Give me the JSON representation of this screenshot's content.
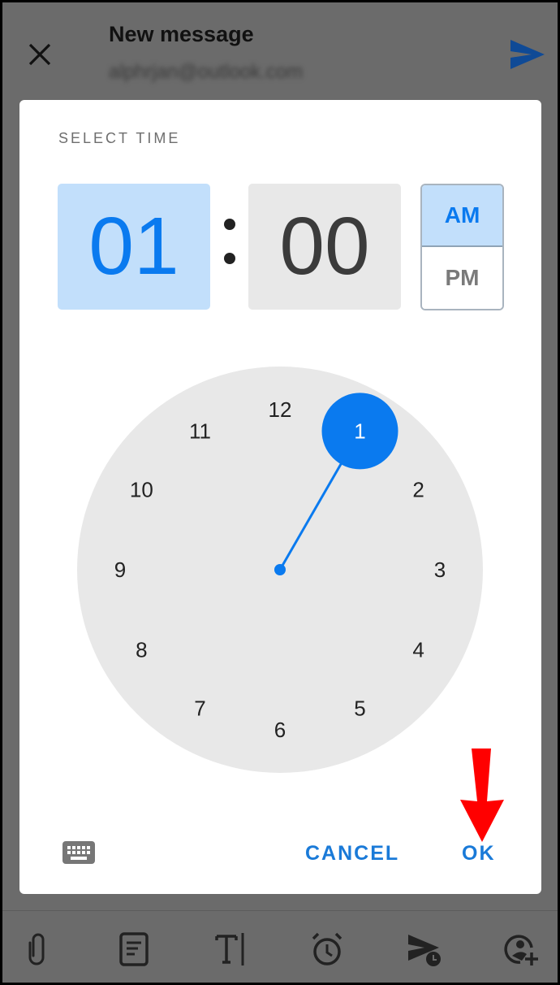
{
  "header": {
    "title": "New message",
    "subtitle": "alphrjan@outlook.com",
    "close_icon": "close-icon",
    "send_icon": "send-icon"
  },
  "dialog": {
    "label": "SELECT TIME",
    "hour": "01",
    "minute": "00",
    "separator": ":",
    "period_options": [
      "AM",
      "PM"
    ],
    "period_selected": "AM",
    "clock": {
      "numbers": [
        "12",
        "1",
        "2",
        "3",
        "4",
        "5",
        "6",
        "7",
        "8",
        "9",
        "10",
        "11"
      ],
      "selected": "1"
    },
    "keyboard_icon": "keyboard-icon",
    "cancel_label": "CANCEL",
    "ok_label": "OK"
  },
  "annotation": {
    "type": "arrow-down",
    "points_to": "OK",
    "color": "#ff0000"
  },
  "toolbar": {
    "items": [
      "attach-icon",
      "template-icon",
      "text-format-icon",
      "reminder-alarm-icon",
      "schedule-send-icon",
      "add-contact-icon"
    ]
  },
  "colors": {
    "accent": "#0a7aef",
    "selected_bg": "#c2dffb",
    "clock_face": "#e8e8e8",
    "button_text": "#1a7ad8",
    "scrim": "#6b6b6b"
  }
}
